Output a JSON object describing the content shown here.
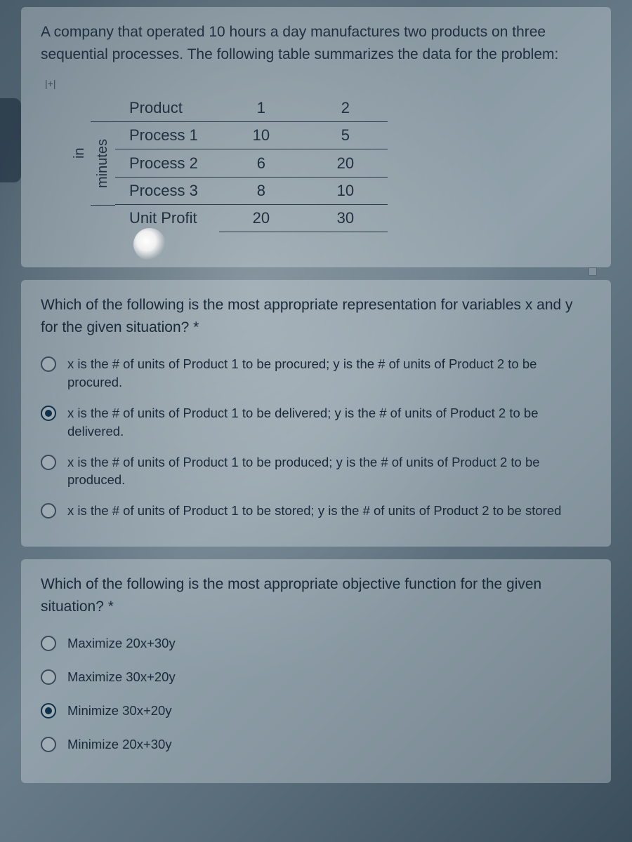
{
  "problem": {
    "intro": "A company that operated 10 hours a day manufactures two products on three sequential processes. The following table summarizes the data for the problem:",
    "side_label_outer": "in",
    "side_label_inner": "minutes",
    "table": {
      "header_label": "Product",
      "col1": "1",
      "col2": "2",
      "rows": [
        {
          "label": "Process 1",
          "v1": "10",
          "v2": "5"
        },
        {
          "label": "Process 2",
          "v1": "6",
          "v2": "20"
        },
        {
          "label": "Process 3",
          "v1": "8",
          "v2": "10"
        },
        {
          "label": "Unit Profit",
          "v1": "20",
          "v2": "30"
        }
      ]
    }
  },
  "q1": {
    "text": "Which of the following is the most appropriate representation for variables x and y for the given situation? *",
    "options": [
      "x is the # of units of Product 1 to be procured; y is the # of units of Product 2 to be procured.",
      "x is the # of units of Product 1 to be delivered; y is the # of units of Product 2 to be delivered.",
      "x is the # of units of Product 1 to be produced; y is the # of units of Product 2 to be produced.",
      "x is the # of units of Product 1 to be stored; y is the # of units of Product 2 to be stored"
    ],
    "selected_index": 1
  },
  "q2": {
    "text": "Which of the following is the most appropriate objective function for the given situation? *",
    "options": [
      "Maximize 20x+30y",
      "Maximize 30x+20y",
      "Minimize 30x+20y",
      "Minimize 20x+30y"
    ],
    "selected_index": 2
  }
}
